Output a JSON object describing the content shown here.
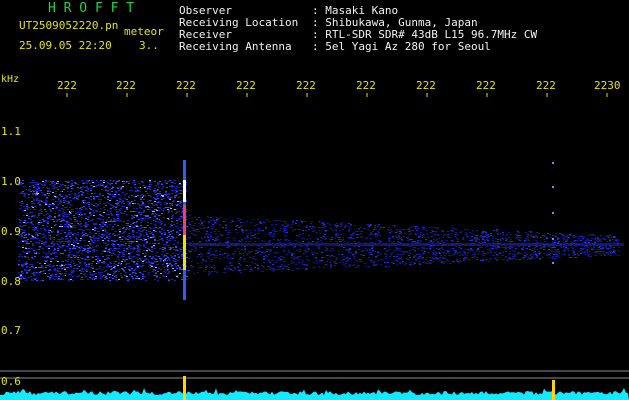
{
  "header": {
    "logo": "H R O F F T",
    "filename": "UT2509052220.pn",
    "tag": "meteor",
    "datetime": "25.09.05 22:20",
    "count": "3..",
    "info": [
      {
        "label": "Observer",
        "value": ": Masaki Kano"
      },
      {
        "label": "Receiving Location",
        "value": ": Shibukawa, Gunma, Japan"
      },
      {
        "label": "Receiver",
        "value": ": RTL-SDR SDR# 43dB L15 96.7MHz CW"
      },
      {
        "label": "Receiving Antenna",
        "value": ": 5el Yagi Az 280 for Seoul"
      }
    ]
  },
  "axis": {
    "unit": "kHz",
    "x_ticks": [
      "222",
      "222",
      "222",
      "222",
      "222",
      "222",
      "222",
      "222",
      "222",
      "2230"
    ],
    "y_ticks": [
      "1.1",
      "1.0",
      "0.9",
      "0.8",
      "0.7",
      "0.6"
    ]
  },
  "colors": {
    "text_yellow": "#e6e600",
    "logo_green": "#19d64a",
    "noise_blue": "#1a2cff",
    "meteor_spike": "#ffd400",
    "baseline_cyan": "#18e8ff"
  }
}
